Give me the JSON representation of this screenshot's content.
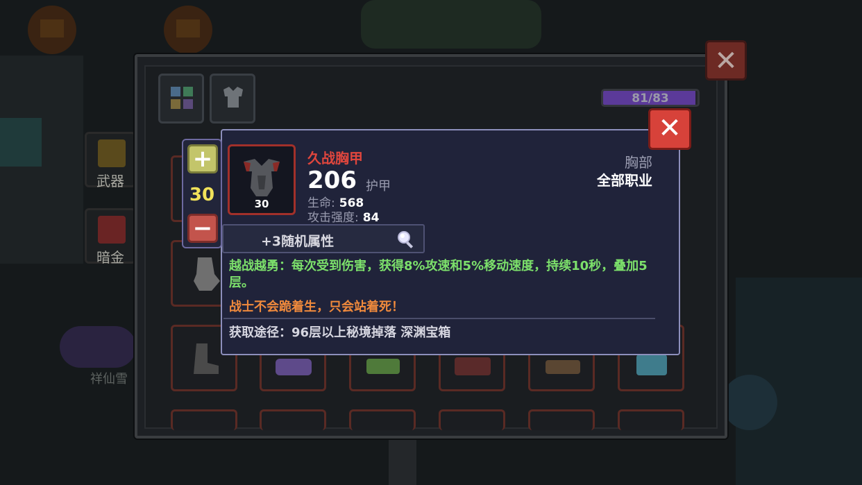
{
  "background": {
    "side_buttons": [
      {
        "label": "武器"
      },
      {
        "label": "暗金"
      }
    ],
    "caption": "祥仙雪"
  },
  "inventory": {
    "capacity_text": "81/83",
    "capacity_fraction": 0.976,
    "tabs": [
      {
        "icon": "grid-icon"
      },
      {
        "icon": "armor-tab-icon"
      }
    ]
  },
  "stepper": {
    "plus_label": "+",
    "minus_label": "−",
    "value": "30"
  },
  "tooltip": {
    "item_name": "久战胸甲",
    "item_level": "30",
    "armor_value": "206",
    "armor_label": "护甲",
    "stats": [
      {
        "key": "生命:",
        "value": "568"
      },
      {
        "key": "攻击强度:",
        "value": "84"
      }
    ],
    "slot_type": "胸部",
    "class_requirement": "全部职业",
    "random_affix": "+3随机属性",
    "passive": "越战越勇：每次受到伤害，获得8%攻速和5%移动速度，持续10秒，叠加5层。",
    "flavor": "战士不会跪着生，只会站着死！",
    "source": "获取途径：96层以上秘境掉落 深渊宝箱",
    "close_label": "✕"
  },
  "outer_close_label": "✕",
  "colors": {
    "item_name": "#e0463d",
    "passive": "#7ce06b",
    "flavor": "#f08a3c",
    "close_red": "#d7423a",
    "stepper_value": "#f2e25a"
  }
}
